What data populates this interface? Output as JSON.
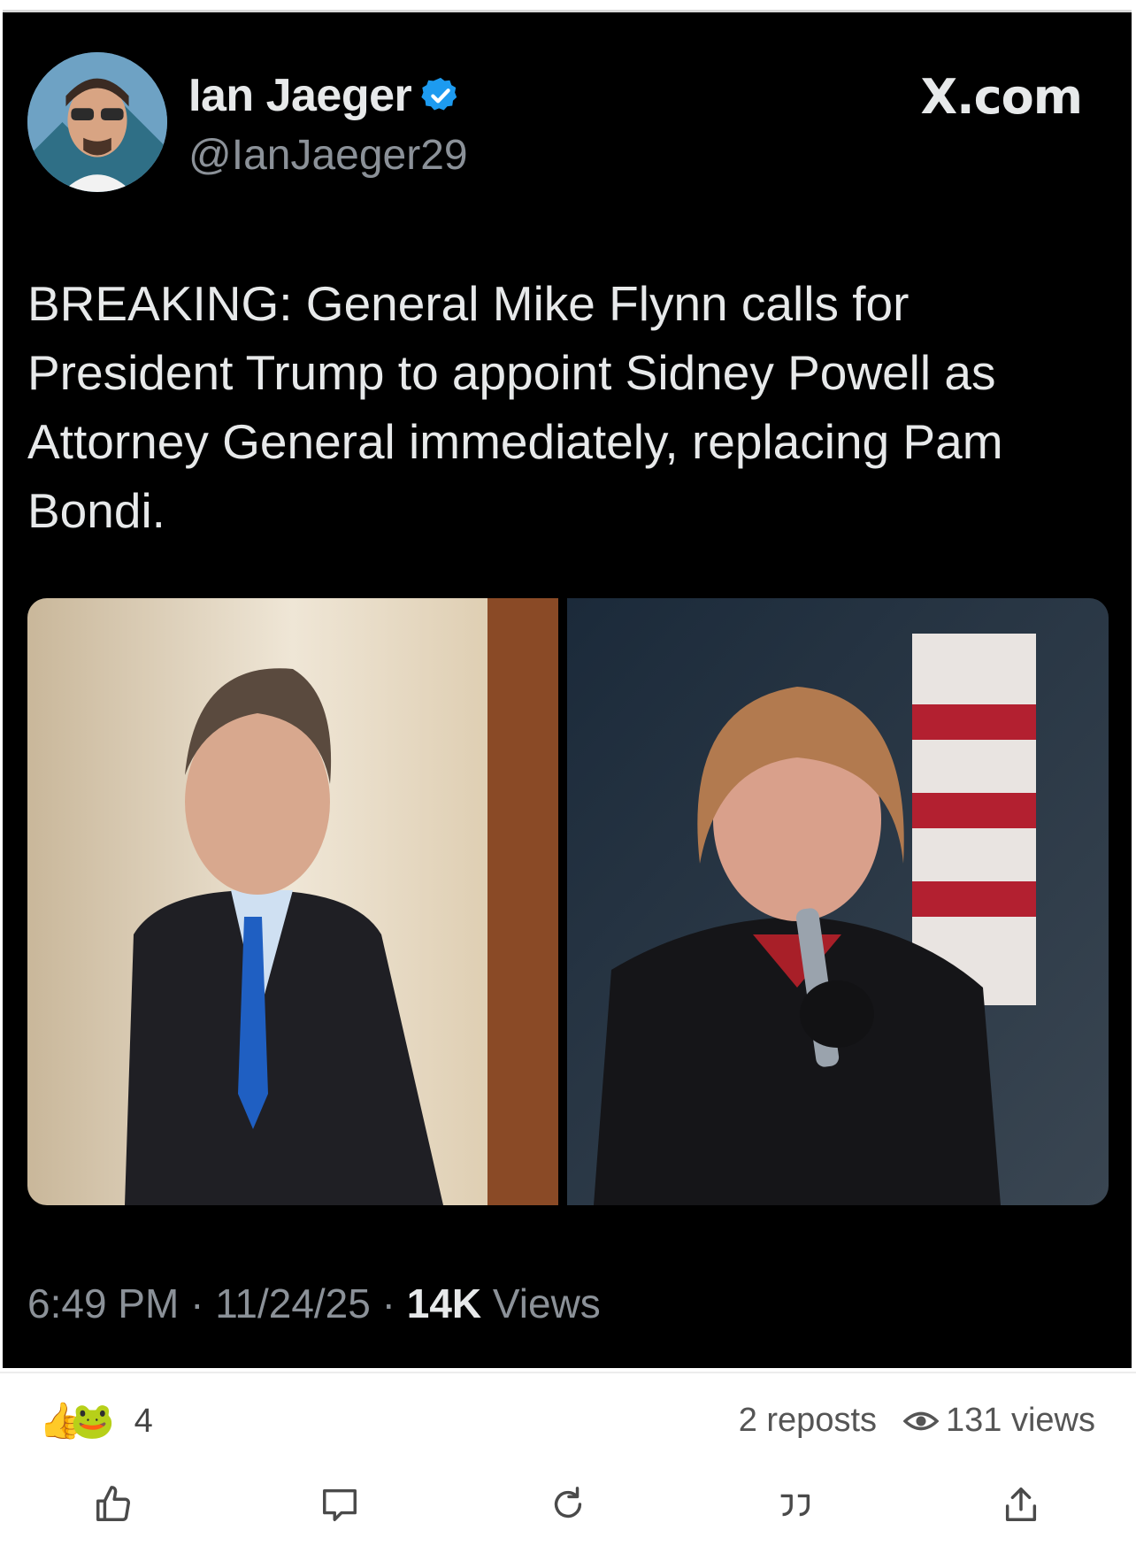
{
  "tweet": {
    "display_name": "Ian Jaeger",
    "handle": "@IanJaeger29",
    "source": "X.com",
    "text": "BREAKING: General Mike Flynn calls for President Trump to appoint Sidney Powell as Attorney General immediately, replacing Pam Bondi.",
    "time": "6:49 PM",
    "date": "11/24/25",
    "views_count": "14K",
    "views_label": "Views",
    "sep": "·"
  },
  "post_footer": {
    "reaction_emojis": [
      "👍",
      "🐸"
    ],
    "reaction_count": "4",
    "reposts": "2 reposts",
    "views": "131 views"
  },
  "icons": {
    "verified": "verified-badge-icon",
    "eye": "eye-icon",
    "actions": [
      "thumbs-up-icon",
      "comment-icon",
      "repost-icon",
      "quote-icon",
      "share-icon"
    ]
  },
  "colors": {
    "tweet_bg": "#000000",
    "text_primary": "#e7e9ea",
    "text_secondary": "#8b9198",
    "verified_blue": "#1d9bf0"
  }
}
